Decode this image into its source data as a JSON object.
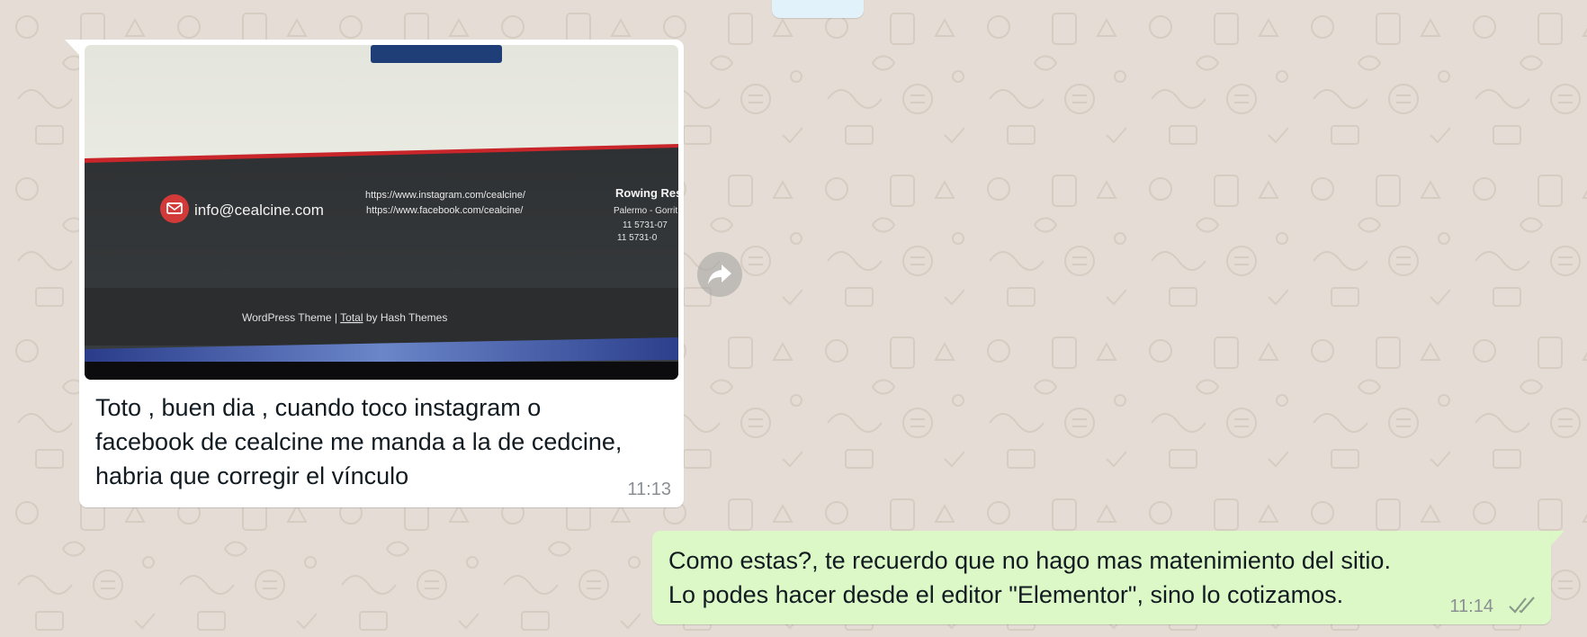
{
  "chat": {
    "background_color": "#e5ddd5",
    "incoming": {
      "attachment_type": "photo",
      "photo": {
        "email": "info@cealcine.com",
        "instagram_url": "https://www.instagram.com/cealcine/",
        "facebook_url": "https://www.facebook.com/cealcine/",
        "business_name": "Rowing Res",
        "location": "Palermo - Gorrit",
        "phone": "11 5731-07",
        "whatsapp": "11 5731-0",
        "footer_prefix": "WordPress Theme | ",
        "footer_theme": "Total",
        "footer_suffix": " by Hash Themes"
      },
      "caption_line1": "Toto , buen dia , cuando toco instagram o",
      "caption_line2": "facebook de cealcine me manda a la de cedcine,",
      "caption_line3": "habria que corregir el vínculo",
      "time": "11:13",
      "forward_icon": "forward-icon"
    },
    "outgoing": {
      "line1": "Como estas?, te recuerdo que no hago mas matenimiento del sitio.",
      "line2": "Lo podes hacer desde el editor \"Elementor\", sino lo cotizamos.",
      "time": "11:14",
      "status_icon": "double-check-icon",
      "bubble_color": "#dcf8c6"
    }
  }
}
